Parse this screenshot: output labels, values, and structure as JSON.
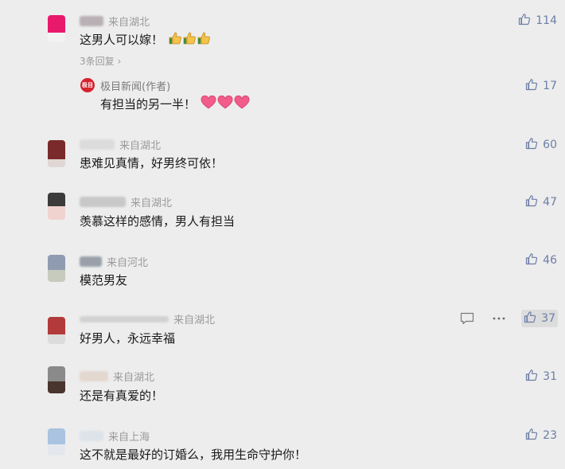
{
  "comments": [
    {
      "location": "来自湖北",
      "text": "这男人可以嫁！",
      "likes": "114",
      "reply_count": "3条回复",
      "avatar_colors": [
        "#e8196a",
        "#f2f2f2"
      ],
      "author_reply": {
        "logo_text": "极目",
        "author": "极目新闻(作者)",
        "text": "有担当的另一半！",
        "likes": "17"
      }
    },
    {
      "location": "来自湖北",
      "text": "患难见真情，好男终可依！",
      "likes": "60",
      "avatar_colors": [
        "#7a2a2a",
        "#e0d6d3"
      ]
    },
    {
      "location": "来自湖北",
      "text": "羡慕这样的感情，男人有担当",
      "likes": "47",
      "avatar_colors": [
        "#3b3b3b",
        "#f0d3cf"
      ]
    },
    {
      "location": "来自河北",
      "text": "模范男友",
      "likes": "46",
      "avatar_colors": [
        "#8f9bb0",
        "#c6cbbd"
      ]
    },
    {
      "location": "来自湖北",
      "text": "好男人，永远幸福",
      "likes": "37",
      "avatar_colors": [
        "#b33a3a",
        "#dcdcdc"
      ]
    },
    {
      "location": "来自湖北",
      "text": "还是有真爱的！",
      "likes": "31",
      "avatar_colors": [
        "#8a8a8a",
        "#4a342e"
      ]
    },
    {
      "location": "来自上海",
      "text": "这不就是最好的订婚么，我用生命守护你！",
      "likes": "23",
      "avatar_colors": [
        "#a9c3e0",
        "#e4e8ee"
      ]
    }
  ],
  "colors": {
    "background": "#ededed",
    "like_accent": "#6c7ea6",
    "meta_gray": "#9a9a9a"
  },
  "icons": {
    "like": "thumbs-up-icon",
    "comment": "comment-bubble-icon",
    "more": "more-dots-icon",
    "emoji_thumb": "thumbs-up-emoji",
    "emoji_heart": "heart-emoji"
  }
}
